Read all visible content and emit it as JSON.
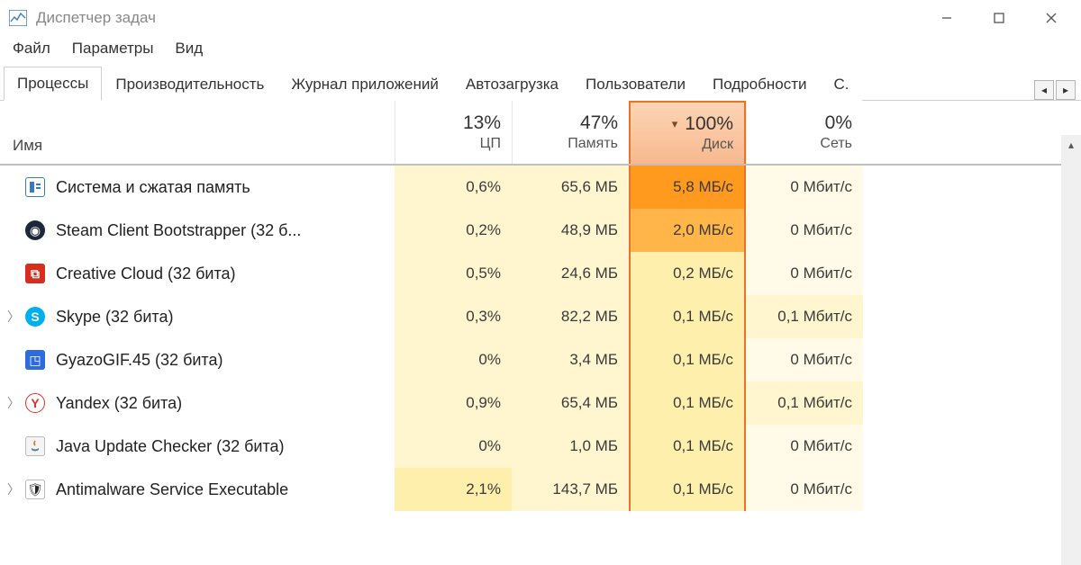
{
  "window": {
    "title": "Диспетчер задач"
  },
  "menu": {
    "file": "Файл",
    "options": "Параметры",
    "view": "Вид"
  },
  "tabs": [
    "Процессы",
    "Производительность",
    "Журнал приложений",
    "Автозагрузка",
    "Пользователи",
    "Подробности",
    "С"
  ],
  "tabs_partial_last": "С.",
  "columns": {
    "name": "Имя",
    "cpu": {
      "pct": "13%",
      "label": "ЦП"
    },
    "mem": {
      "pct": "47%",
      "label": "Память"
    },
    "disk": {
      "pct": "100%",
      "label": "Диск"
    },
    "net": {
      "pct": "0%",
      "label": "Сеть"
    }
  },
  "rows": [
    {
      "expand": false,
      "icon": "system",
      "name": "Система и сжатая память",
      "cpu": "0,6%",
      "mem": "65,6 МБ",
      "disk": "5,8 МБ/с",
      "net": "0 Мбит/с",
      "disk_heat": "h-or3"
    },
    {
      "expand": false,
      "icon": "steam",
      "name": "Steam Client Bootstrapper (32 б...",
      "cpu": "0,2%",
      "mem": "48,9 МБ",
      "disk": "2,0 МБ/с",
      "net": "0 Мбит/с",
      "disk_heat": "h-or2"
    },
    {
      "expand": false,
      "icon": "creative",
      "name": "Creative Cloud (32 бита)",
      "cpu": "0,5%",
      "mem": "24,6 МБ",
      "disk": "0,2 МБ/с",
      "net": "0 Мбит/с",
      "disk_heat": "h-y2"
    },
    {
      "expand": true,
      "icon": "skype",
      "name": "Skype (32 бита)",
      "cpu": "0,3%",
      "mem": "82,2 МБ",
      "disk": "0,1 МБ/с",
      "net": "0,1 Мбит/с",
      "disk_heat": "h-y2",
      "net_heat": "h-y1"
    },
    {
      "expand": false,
      "icon": "gyazo",
      "name": "GyazoGIF.45 (32 бита)",
      "cpu": "0%",
      "mem": "3,4 МБ",
      "disk": "0,1 МБ/с",
      "net": "0 Мбит/с",
      "disk_heat": "h-y2"
    },
    {
      "expand": true,
      "icon": "yandex",
      "name": "Yandex (32 бита)",
      "cpu": "0,9%",
      "mem": "65,4 МБ",
      "disk": "0,1 МБ/с",
      "net": "0,1 Мбит/с",
      "disk_heat": "h-y2",
      "net_heat": "h-y1"
    },
    {
      "expand": false,
      "icon": "java",
      "name": "Java Update Checker (32 бита)",
      "cpu": "0%",
      "mem": "1,0 МБ",
      "disk": "0,1 МБ/с",
      "net": "0 Мбит/с",
      "disk_heat": "h-y2"
    },
    {
      "expand": true,
      "icon": "shield",
      "name": "Antimalware Service Executable",
      "cpu": "2,1%",
      "mem": "143,7 МБ",
      "disk": "0,1 МБ/с",
      "net": "0 Мбит/с",
      "disk_heat": "h-y2",
      "cpu_heat": "h-y2"
    }
  ]
}
